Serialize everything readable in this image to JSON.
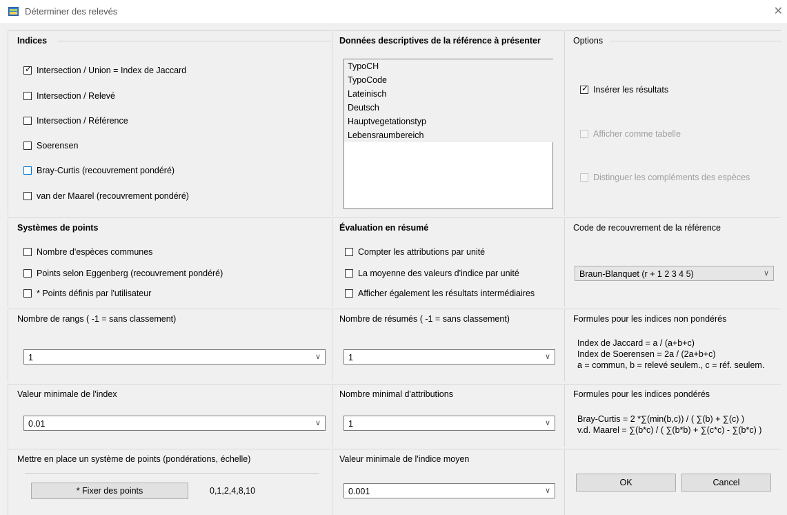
{
  "window": {
    "title": "Déterminer des relevés",
    "close_glyph": "✕"
  },
  "indices": {
    "title": "Indices",
    "items": [
      {
        "label": "Intersection / Union = Index de Jaccard",
        "checked": true
      },
      {
        "label": "Intersection / Relevé",
        "checked": false
      },
      {
        "label": "Intersection / Référence",
        "checked": false
      },
      {
        "label": "Soerensen",
        "checked": false
      },
      {
        "label": "Bray-Curtis (recouvrement pondéré)",
        "checked": false
      },
      {
        "label": "van der Maarel (recouvrement pondéré)",
        "checked": false
      }
    ]
  },
  "descriptive": {
    "title": "Données descriptives de la référence à présenter",
    "items": [
      "TypoCH",
      "TypoCode",
      "Lateinisch",
      "Deutsch",
      "Hauptvegetationstyp",
      "Lebensraumbereich"
    ]
  },
  "options": {
    "title": "Options",
    "items": [
      {
        "label": "Insérer les résultats",
        "checked": true,
        "disabled": false
      },
      {
        "label": "Afficher comme tabelle",
        "checked": false,
        "disabled": true
      },
      {
        "label": "Distinguer les compléments des espèces",
        "checked": false,
        "disabled": true
      }
    ]
  },
  "points_systems": {
    "title": "Systèmes de points",
    "items": [
      {
        "label": "Nombre d'espèces communes",
        "checked": false
      },
      {
        "label": "Points selon Eggenberg (recouvrement pondéré)",
        "checked": false
      },
      {
        "label": "* Points définis par l'utilisateur",
        "checked": false
      }
    ]
  },
  "summary_eval": {
    "title": "Évaluation en résumé",
    "items": [
      {
        "label": "Compter les attributions par unité",
        "checked": false
      },
      {
        "label": "La moyenne des valeurs d'indice par unité",
        "checked": false
      },
      {
        "label": "Afficher également les résultats intermédiaires",
        "checked": false
      }
    ]
  },
  "cover_code": {
    "title": "Code de recouvrement de la référence",
    "value": "Braun-Blanquet (r + 1 2 3 4 5)"
  },
  "ranks": {
    "title": "Nombre de rangs ( -1 = sans classement)",
    "value": "1"
  },
  "summaries": {
    "title": "Nombre de résumés ( -1 = sans classement)",
    "value": "1"
  },
  "unweighted": {
    "title": "Formules pour les indices non pondérés",
    "lines": [
      "Index de Jaccard = a / (a+b+c)",
      "Index de Soerensen = 2a / (2a+b+c)",
      "a = commun, b = relevé seulem., c = réf. seulem."
    ]
  },
  "min_index": {
    "title": "Valeur minimale de l'index",
    "value": "0.01"
  },
  "min_attrib": {
    "title": "Nombre minimal d'attributions",
    "value": "1"
  },
  "weighted": {
    "title": "Formules pour les indices pondérés",
    "lines": [
      "Bray-Curtis = 2 *∑(min(b,c)) / ( ∑(b) + ∑(c) )",
      "v.d. Maarel = ∑(b*c) / ( ∑(b*b) + ∑(c*c) - ∑(b*c) )"
    ]
  },
  "points_setup": {
    "title": "Mettre en place un système de points (pondérations, échelle)",
    "button": "* Fixer des points",
    "scale": "0,1,2,4,8,10"
  },
  "min_mean": {
    "title": "Valeur minimale de l'indice moyen",
    "value": "0.001"
  },
  "buttons": {
    "ok": "OK",
    "cancel": "Cancel"
  },
  "colors": {
    "focus_blue": "#0078d7",
    "background": "#f0f0f0"
  },
  "icons": {
    "checkbox_tick": "✓",
    "dropdown": "chevron-down-icon"
  }
}
